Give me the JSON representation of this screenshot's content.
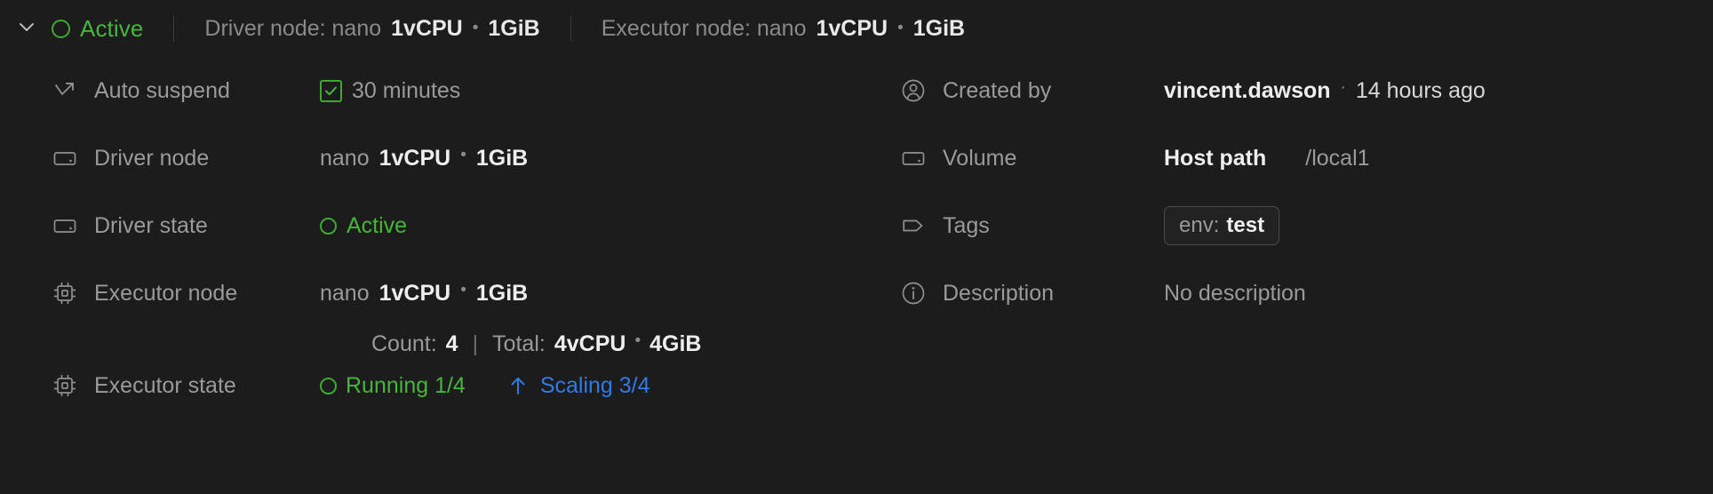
{
  "header": {
    "expand_icon": "chevron-down-icon",
    "status_icon": "status-ring-icon",
    "status": "Active",
    "driver": {
      "label": "Driver node: nano",
      "cpu": "1vCPU",
      "sep": "•",
      "memory": "1GiB"
    },
    "executor": {
      "label": "Executor node: nano",
      "cpu": "1vCPU",
      "sep": "•",
      "memory": "1GiB"
    }
  },
  "left_column": {
    "auto_suspend": {
      "icon": "auto-suspend-arrow-icon",
      "label": "Auto suspend",
      "checkbox_icon": "checkbox-checked-icon",
      "value": "30 minutes"
    },
    "driver_node": {
      "icon": "node-icon",
      "label": "Driver node",
      "size": "nano",
      "cpu": "1vCPU",
      "sep": "•",
      "memory": "1GiB"
    },
    "driver_state": {
      "icon": "node-icon",
      "label": "Driver state",
      "status_icon": "status-ring-icon",
      "value": "Active"
    },
    "executor_node": {
      "icon": "cpu-chip-icon",
      "label": "Executor node",
      "size": "nano",
      "cpu": "1vCPU",
      "sep": "•",
      "memory": "1GiB",
      "count_label": "Count:",
      "count_value": "4",
      "divider": "|",
      "total_label": "Total:",
      "total_cpu": "4vCPU",
      "total_sep": "•",
      "total_memory": "4GiB"
    },
    "executor_state": {
      "icon": "cpu-chip-icon",
      "label": "Executor state",
      "running_icon": "status-ring-icon",
      "running": "Running 1/4",
      "scaling_icon": "arrow-up-icon",
      "scaling": "Scaling 3/4"
    }
  },
  "right_column": {
    "created_by": {
      "icon": "user-circle-icon",
      "label": "Created by",
      "user": "vincent.dawson",
      "sep": "·",
      "time": "14 hours ago"
    },
    "volume": {
      "icon": "node-icon",
      "label": "Volume",
      "type": "Host path",
      "path": "/local1"
    },
    "tags": {
      "icon": "tag-icon",
      "label": "Tags",
      "chips": [
        {
          "key": "env:",
          "value": "test"
        }
      ]
    },
    "description": {
      "icon": "info-circle-icon",
      "label": "Description",
      "value": "No description"
    }
  },
  "colors": {
    "background": "#1c1c1c",
    "green": "#47b53c",
    "blue": "#2f7ae5",
    "muted": "#9a9a9a",
    "strong": "#eeeeee"
  }
}
